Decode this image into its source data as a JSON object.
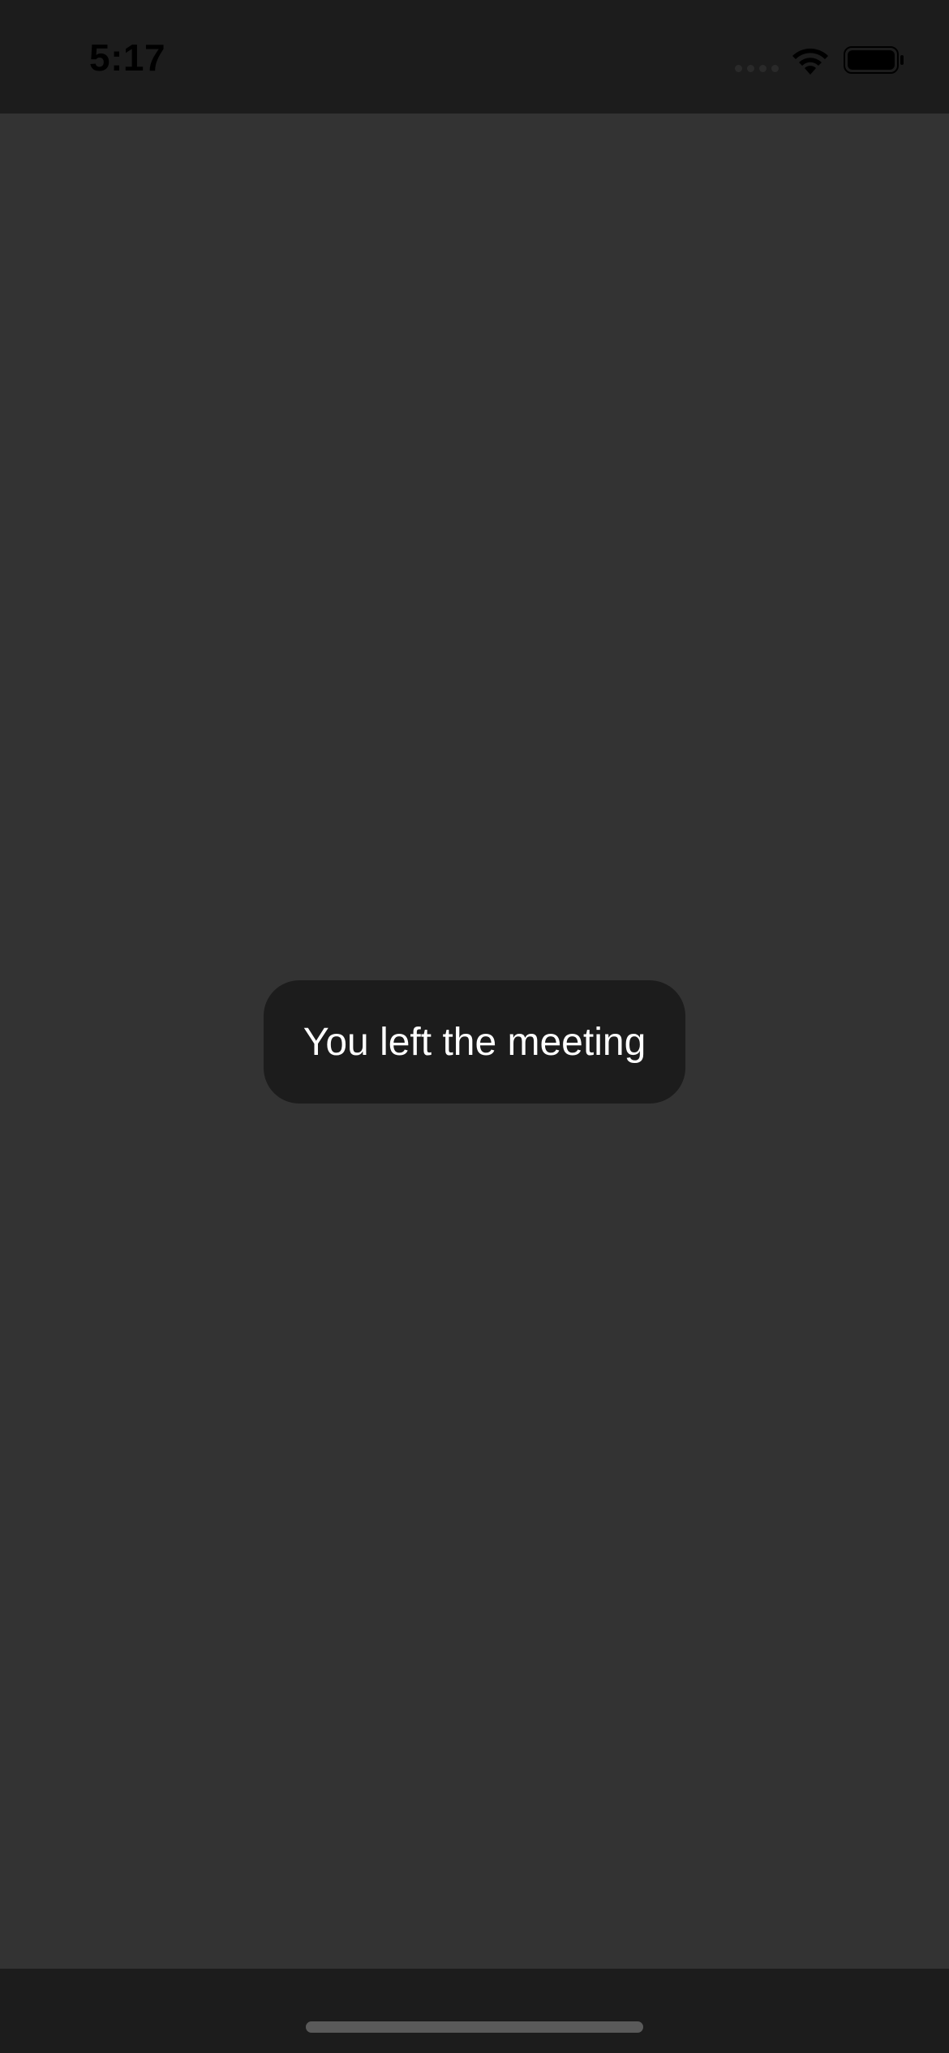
{
  "status_bar": {
    "time": "5:17",
    "icons": [
      "signal-dots-icon",
      "wifi-icon",
      "battery-icon"
    ]
  },
  "toast": {
    "message": "You left the meeting"
  },
  "colors": {
    "background": "#333333",
    "bars": "#1c1c1c",
    "toast_background": "#1c1c1c",
    "toast_text": "#ffffff",
    "home_indicator": "#5a5a5a"
  }
}
